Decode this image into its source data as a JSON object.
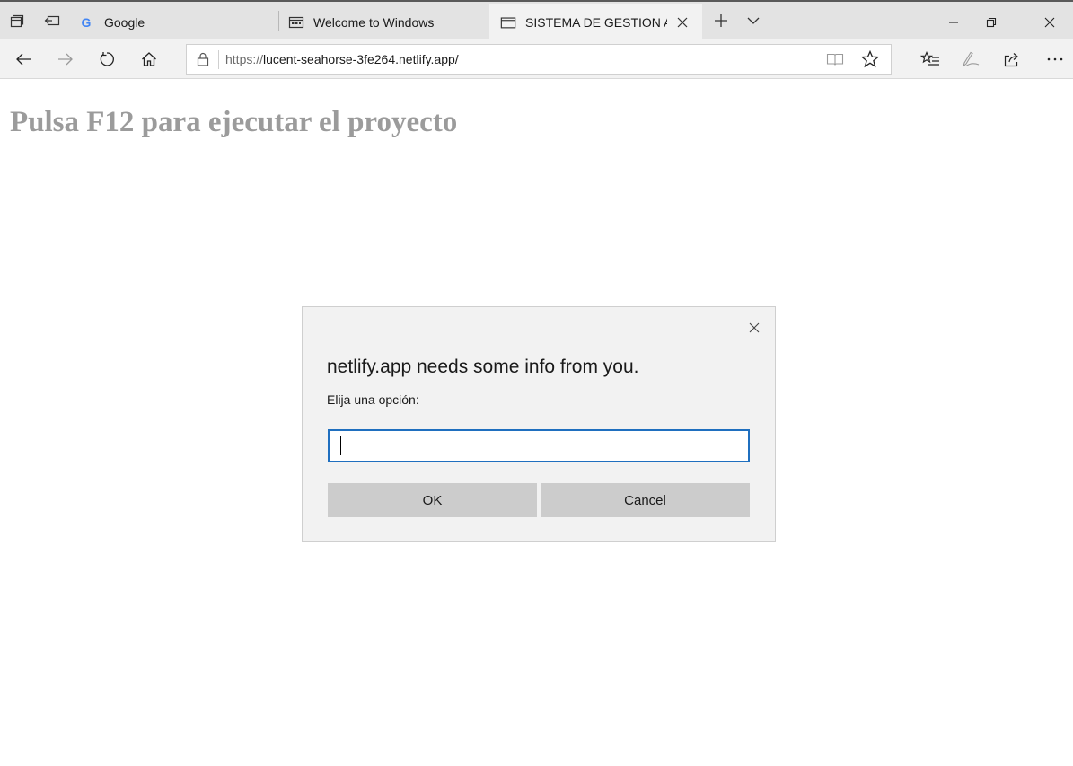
{
  "browser": {
    "tabs": [
      {
        "label": "Google",
        "icon": "google-icon"
      },
      {
        "label": "Welcome to Windows",
        "icon": "window-icon"
      },
      {
        "label": "SISTEMA DE GESTION A",
        "icon": "browser-tab-icon",
        "active": true
      }
    ],
    "address": {
      "scheme": "https://",
      "host": "lucent-seahorse-3fe264.netlify.app/"
    }
  },
  "page": {
    "heading": "Pulsa F12 para ejecutar el proyecto"
  },
  "dialog": {
    "title": "netlify.app needs some info from you.",
    "message": "Elija una opción:",
    "input_value": "",
    "ok_label": "OK",
    "cancel_label": "Cancel"
  },
  "colors": {
    "heading": "#9b9b9b",
    "input_border": "#1f6fbf",
    "button_bg": "#cccccc",
    "dialog_bg": "#f2f2f2"
  }
}
